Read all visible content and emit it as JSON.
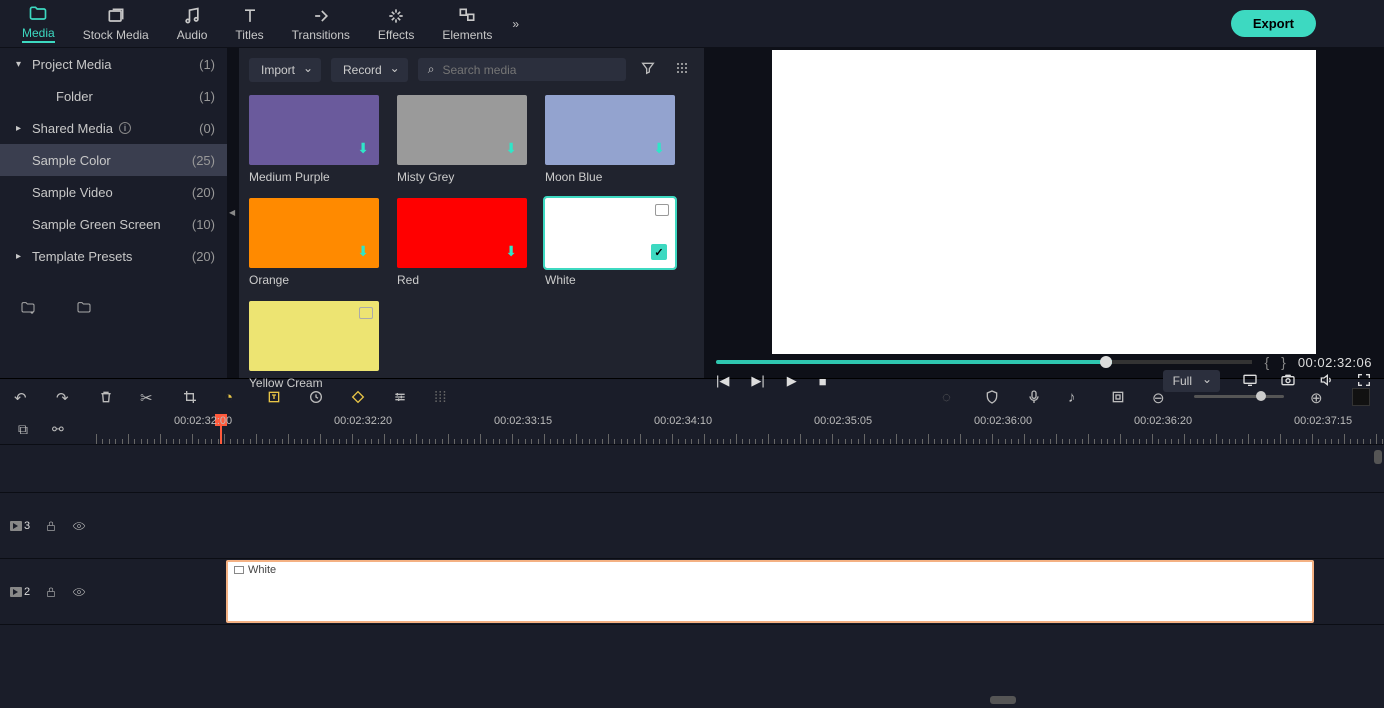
{
  "tabs": [
    "Media",
    "Stock Media",
    "Audio",
    "Titles",
    "Transitions",
    "Effects",
    "Elements"
  ],
  "export": "Export",
  "sidebar": [
    {
      "label": "Project Media",
      "count": "(1)",
      "arrow": "▾",
      "child": false
    },
    {
      "label": "Folder",
      "count": "(1)",
      "arrow": "",
      "child": true
    },
    {
      "label": "Shared Media",
      "count": "(0)",
      "arrow": "▸",
      "child": false,
      "info": true
    },
    {
      "label": "Sample Color",
      "count": "(25)",
      "arrow": "",
      "child": false,
      "active": true
    },
    {
      "label": "Sample Video",
      "count": "(20)",
      "arrow": "",
      "child": false
    },
    {
      "label": "Sample Green Screen",
      "count": "(10)",
      "arrow": "",
      "child": false
    },
    {
      "label": "Template Presets",
      "count": "(20)",
      "arrow": "▸",
      "child": false
    }
  ],
  "import": "Import",
  "record": "Record",
  "search_ph": "Search media",
  "swatches": [
    {
      "name": "Medium Purple",
      "color": "#6a5a9c",
      "dl": true
    },
    {
      "name": "Misty Grey",
      "color": "#9a9a9a",
      "dl": true
    },
    {
      "name": "Moon Blue",
      "color": "#93a3cf",
      "dl": true
    },
    {
      "name": "Orange",
      "color": "#ff8a00",
      "dl": true
    },
    {
      "name": "Red",
      "color": "#ff0000",
      "dl": true
    },
    {
      "name": "White",
      "color": "#ffffff",
      "selected": true
    },
    {
      "name": "Yellow Cream",
      "color": "#ede472",
      "chip": true
    }
  ],
  "timecode": "00:02:32:06",
  "quality": "Full",
  "ruler": [
    "00:02:32:00",
    "00:02:32:20",
    "00:02:33:15",
    "00:02:34:10",
    "00:02:35:05",
    "00:02:36:00",
    "00:02:36:20",
    "00:02:37:15"
  ],
  "tracks": {
    "t3": "3",
    "t2": "2"
  },
  "clip_label": "White"
}
